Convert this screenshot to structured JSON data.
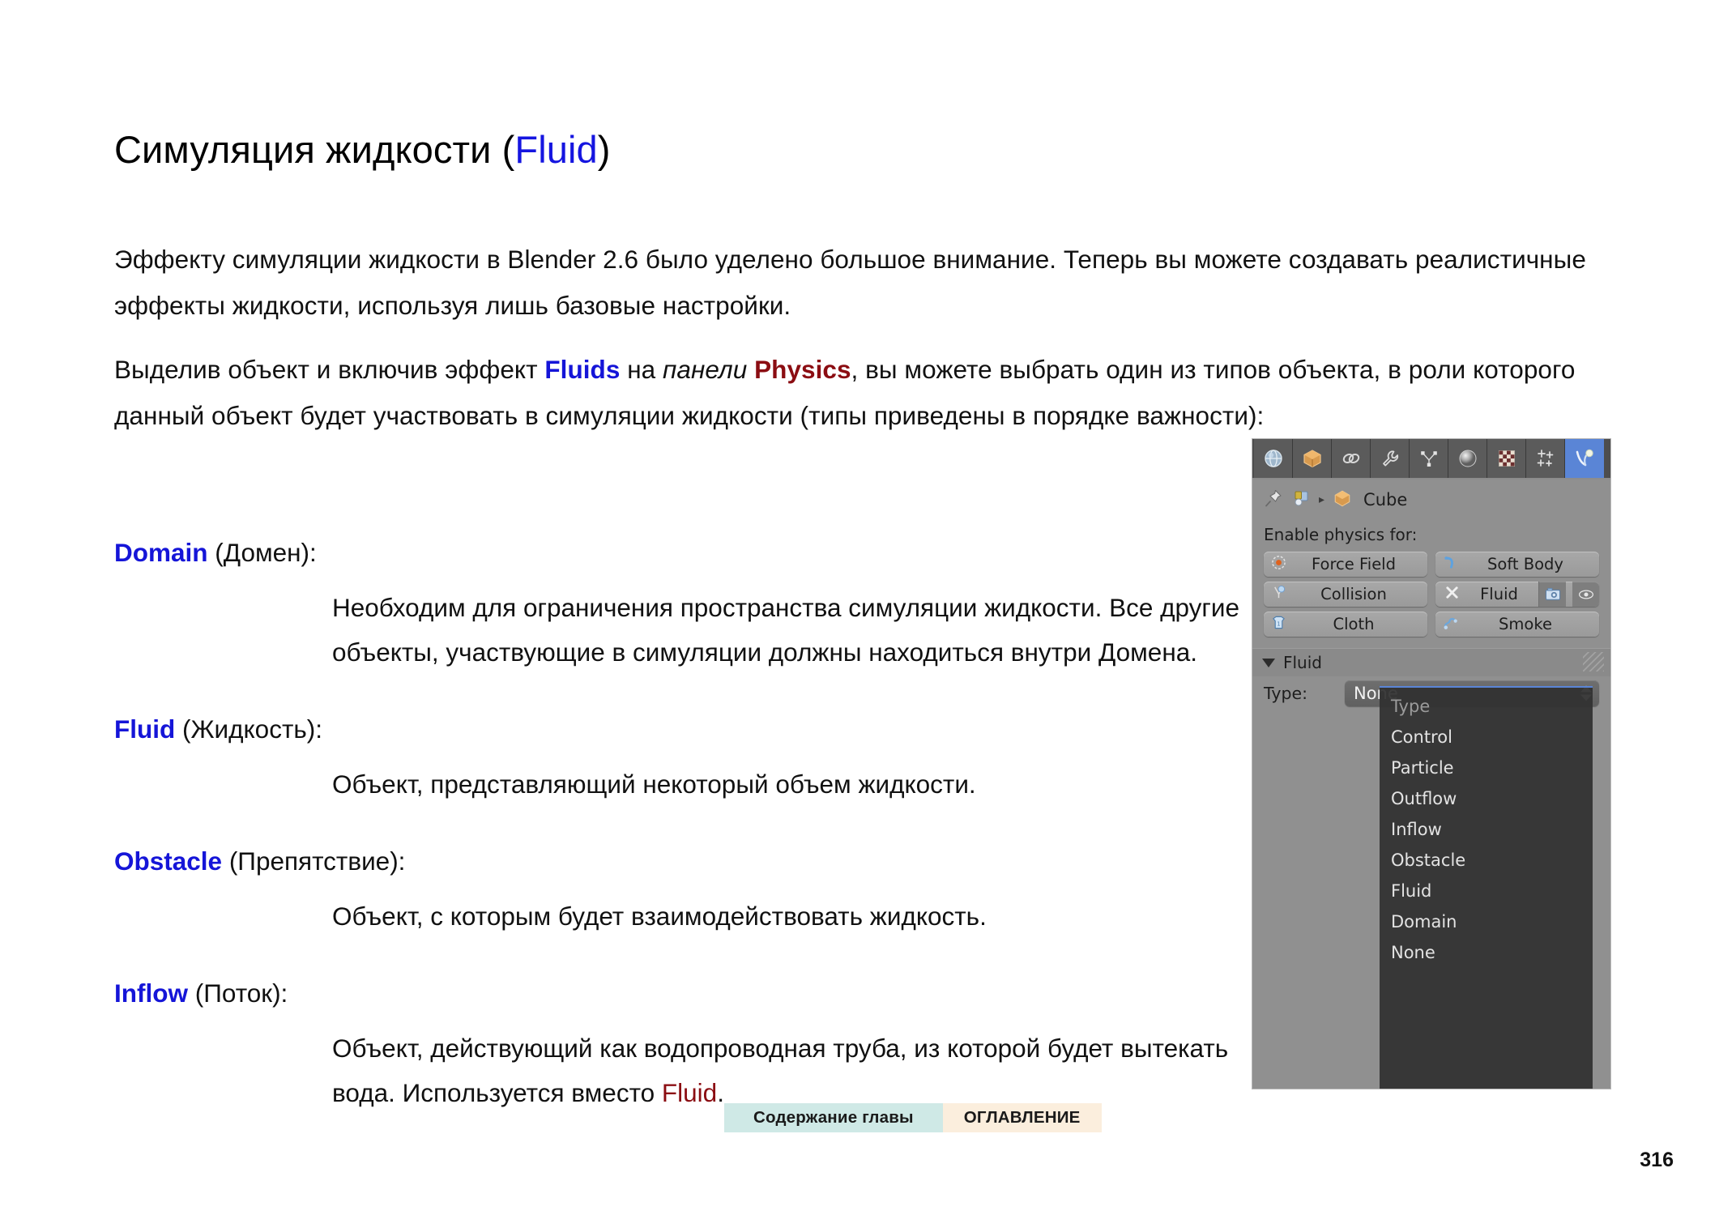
{
  "document": {
    "title_prefix": "Симуляция жидкости (",
    "title_accent": "Fluid",
    "title_suffix": ")",
    "page_number": "316"
  },
  "intro": {
    "paragraph_1": "Эффекту симуляции жидкости в Blender 2.6 было уделено большое внимание. Теперь вы можете создавать реалистичные эффекты жидкости, используя лишь базовые настройки.",
    "paragraph_2": {
      "part_1": "Выделив объект и включив эффект ",
      "kw_fluids": "Fluids",
      "part_2": " на ",
      "kw_panel_italic": "панели",
      "part_3": " ",
      "kw_physics": "Physics",
      "part_4": ", вы можете выбрать один из типов объекта, в роли которого данный объект будет участвовать в симуляции жидкости (типы приведены в порядке важности):"
    }
  },
  "definitions": [
    {
      "term_en": "Domain",
      "term_ru": " (Домен):",
      "body": "Необходим для ограничения пространства симуляции жидкости. Все другие объекты, участвующие в симуляции должны находиться внутри Домена."
    },
    {
      "term_en": "Fluid",
      "term_ru": " (Жидкость):",
      "body": "Объект, представляющий некоторый объем жидкости."
    },
    {
      "term_en": "Obstacle",
      "term_ru": " (Препятствие):",
      "body": "Объект, с которым будет взаимодействовать жидкость."
    },
    {
      "term_en": "Inflow",
      "term_ru": " (Поток):",
      "body_part_1": "Объект, действующий как водопроводная труба, из которой будет вытекать вода. Используется вместо ",
      "body_kw": "Fluid",
      "body_part_2": "."
    }
  ],
  "footer": {
    "chapter_link": "Содержание главы",
    "toc_link": "ОГЛАВЛЕНИЕ"
  },
  "blender_panel": {
    "tabs": [
      {
        "name": "render-tab",
        "icon": "globe-icon"
      },
      {
        "name": "object-tab",
        "icon": "cube-icon"
      },
      {
        "name": "constraints-tab",
        "icon": "link-icon"
      },
      {
        "name": "modifiers-tab",
        "icon": "wrench-icon"
      },
      {
        "name": "particles-tab",
        "icon": "particles-icon"
      },
      {
        "name": "material-tab",
        "icon": "sphere-icon"
      },
      {
        "name": "texture-tab",
        "icon": "checker-icon"
      },
      {
        "name": "effects-tab",
        "icon": "sparkles-icon"
      },
      {
        "name": "physics-tab",
        "icon": "physics-icon"
      }
    ],
    "breadcrumb": {
      "object_name": "Cube",
      "arrow": "▸"
    },
    "enable_physics_label": "Enable physics for:",
    "physics_buttons": [
      {
        "label": "Force Field",
        "icon": "force-field-icon"
      },
      {
        "label": "Soft Body",
        "icon": "soft-body-icon"
      },
      {
        "label": "Collision",
        "icon": "collision-icon"
      },
      {
        "label": "Fluid",
        "icon": "fluid-x-icon",
        "toggles": [
          "camera-icon",
          "eye-icon"
        ]
      },
      {
        "label": "Cloth",
        "icon": "cloth-icon"
      },
      {
        "label": "Smoke",
        "icon": "smoke-icon"
      }
    ],
    "fluid_panel": {
      "title": "Fluid",
      "type_label": "Type:",
      "type_value": "None"
    },
    "dropdown": {
      "header": "Type",
      "items": [
        "Control",
        "Particle",
        "Outflow",
        "Inflow",
        "Obstacle",
        "Fluid",
        "Domain",
        "None"
      ]
    }
  },
  "colors": {
    "accent_blue": "#1515d8",
    "accent_red": "#8b0d12",
    "chapter_link_bg": "#cfe9e6",
    "toc_link_bg": "#fbeedd",
    "blender_bg": "#909090",
    "blender_active_tab": "#5a85d6"
  }
}
